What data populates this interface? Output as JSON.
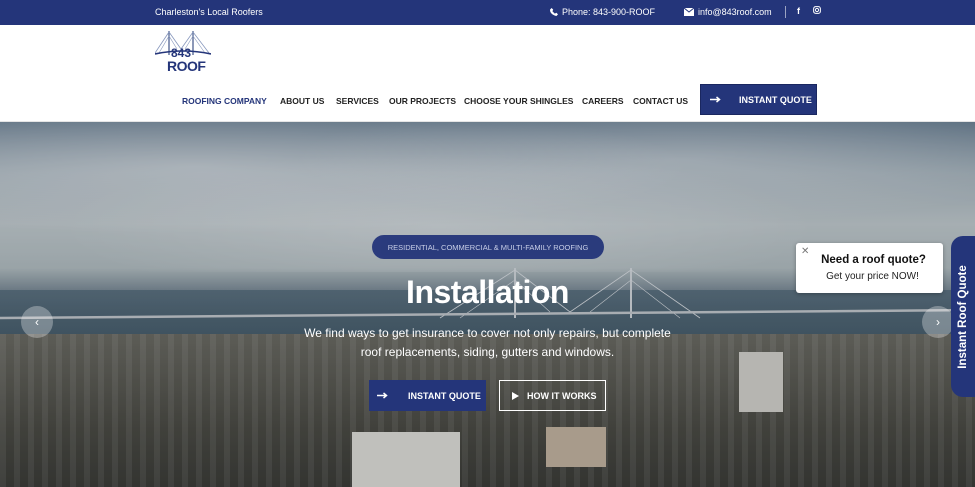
{
  "topbar": {
    "tagline": "Charleston's Local Roofers",
    "phone": "Phone: 843-900-ROOF",
    "email": "info@843roof.com",
    "phone_icon": "phone-icon",
    "email_icon": "envelope-icon",
    "social": [
      "facebook-icon",
      "instagram-icon"
    ]
  },
  "logo": {
    "number": "843",
    "word": "ROOF"
  },
  "nav": {
    "items": [
      "ROOFING COMPANY",
      "ABOUT US",
      "SERVICES",
      "OUR PROJECTS",
      "CHOOSE YOUR SHINGLES",
      "CAREERS",
      "CONTACT US"
    ],
    "active": "ROOFING COMPANY",
    "quote_label": "INSTANT QUOTE"
  },
  "hero": {
    "badge": "RESIDENTIAL, COMMERCIAL & MULTI-FAMILY ROOFING",
    "title": "Installation",
    "subtitle_line1": "We find ways to get insurance to cover not only repairs, but complete",
    "subtitle_line2": "roof replacements, siding, gutters and windows.",
    "button_primary": "INSTANT QUOTE",
    "button_secondary": "HOW IT WORKS"
  },
  "popup": {
    "title": "Need a roof quote?",
    "subtitle": "Get your price NOW!"
  },
  "side_tab": {
    "label": "Instant Roof Quote"
  },
  "colors": {
    "brand": "#24357a",
    "white": "#ffffff"
  }
}
